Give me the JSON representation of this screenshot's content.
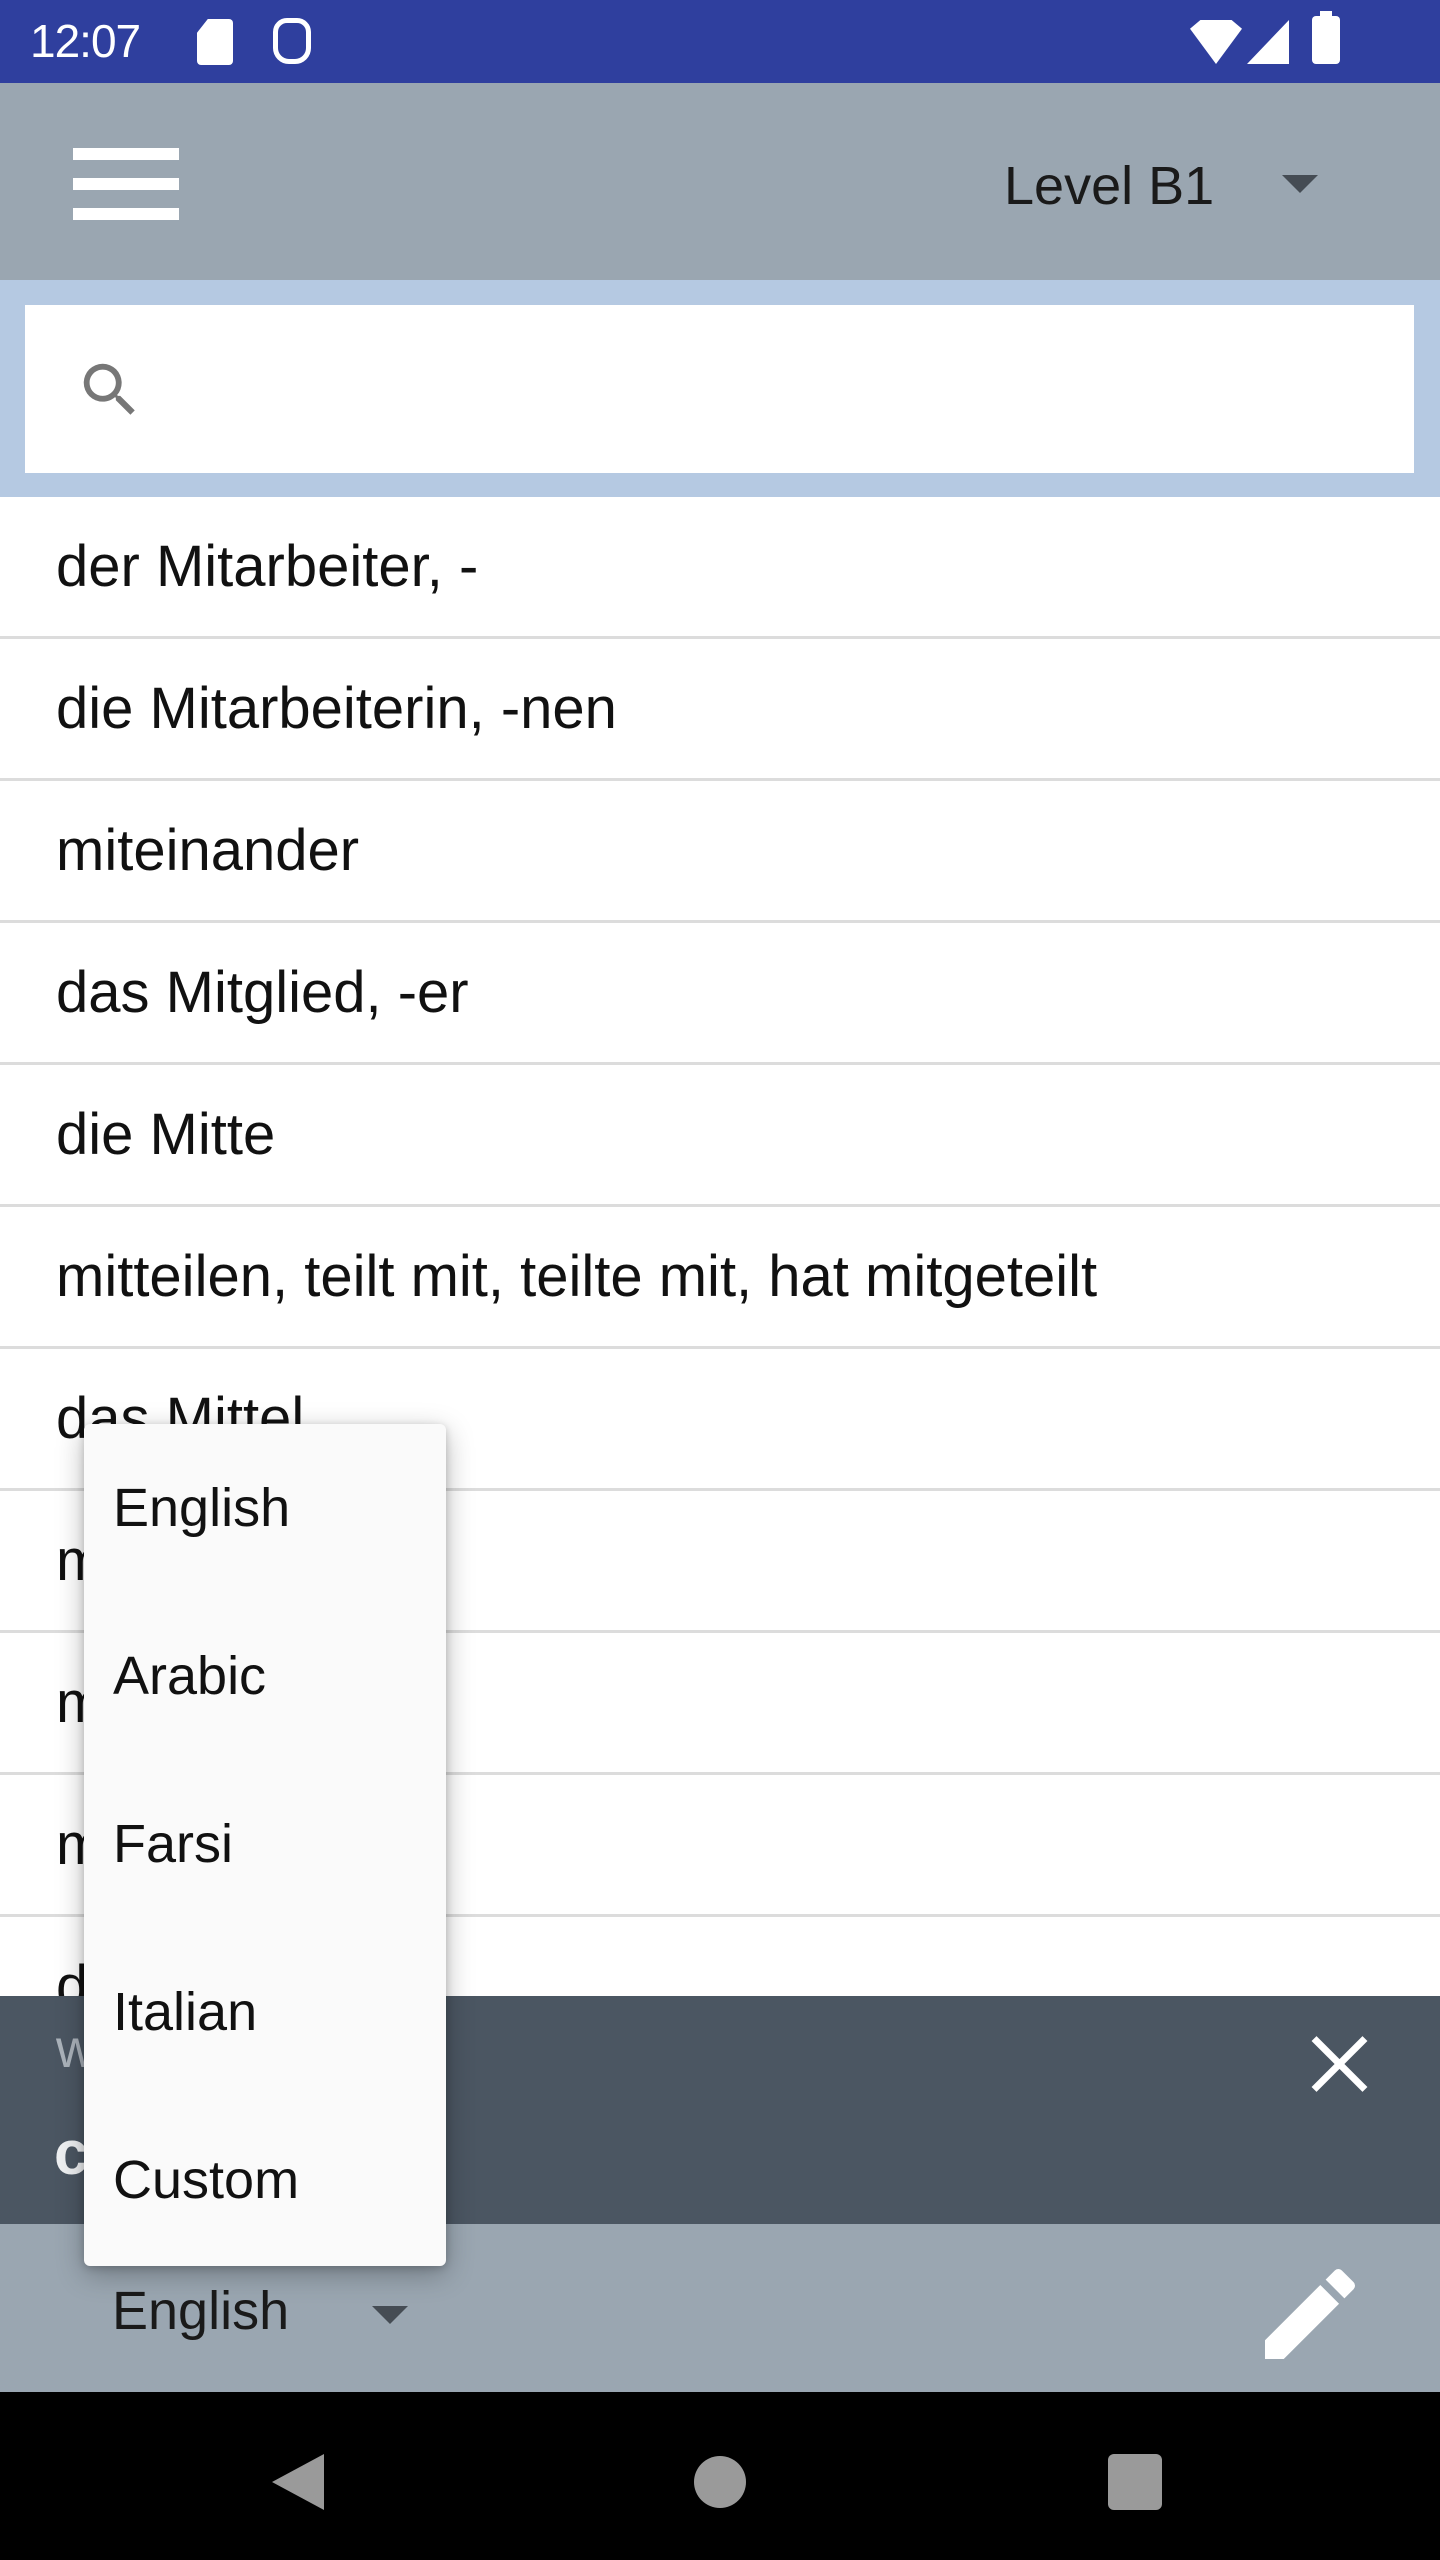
{
  "status_bar": {
    "time": "12:07",
    "icons": [
      "sd-card-icon",
      "ghost-icon",
      "wifi-icon",
      "signal-icon",
      "battery-icon"
    ]
  },
  "app_bar": {
    "menu_icon": "hamburger-menu-icon",
    "level_selected": "Level B1"
  },
  "search": {
    "placeholder": "",
    "value": ""
  },
  "word_list": [
    "der Mitarbeiter, -",
    "die Mitarbeiterin, -nen",
    "miteinander",
    "das Mitglied, -er",
    "die Mitte",
    "mitteilen, teilt mit, teilte mit, hat mitgeteilt",
    "das Mittel",
    "m",
    "m",
    "m",
    "d"
  ],
  "banner": {
    "subtitle": "w",
    "word": "c",
    "close_icon": "close-icon"
  },
  "bottom_bar": {
    "language_selected": "English",
    "edit_icon": "pencil-icon"
  },
  "language_dropdown": {
    "options": [
      "English",
      "Arabic",
      "Farsi",
      "Italian",
      "Custom"
    ]
  },
  "nav_bar": {
    "buttons": [
      "back",
      "home",
      "recents"
    ]
  },
  "colors": {
    "status_bar": "#2f3f9e",
    "app_bar": "#9aa6b1",
    "search_strip": "#b5c9e2",
    "banner": "#4b5662",
    "dropdown_bg": "#fafafa"
  }
}
